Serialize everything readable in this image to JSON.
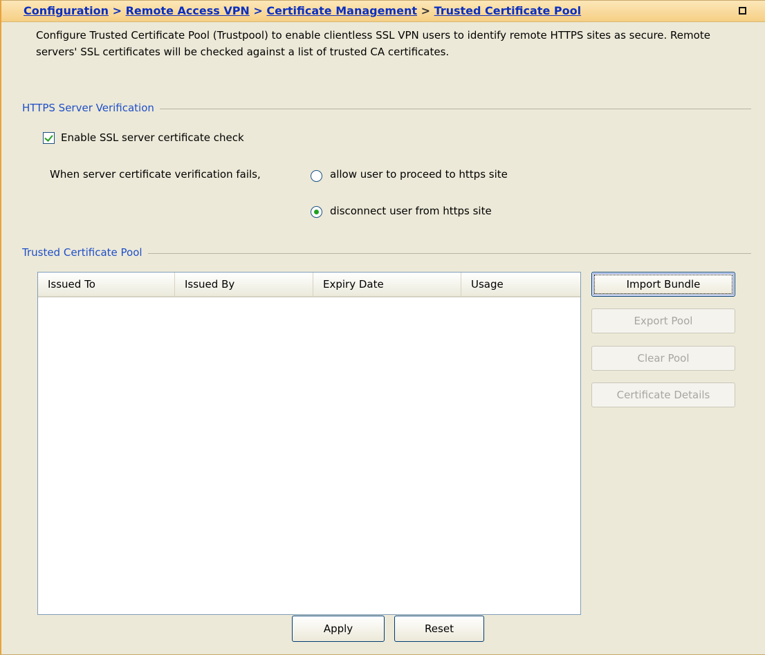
{
  "header": {
    "breadcrumb": [
      "Configuration",
      "Remote Access VPN",
      "Certificate Management",
      "Trusted Certificate Pool"
    ],
    "separator": ">"
  },
  "description": "Configure Trusted Certificate Pool (Trustpool) to enable clientless SSL VPN users to identify remote HTTPS sites as secure. Remote servers' SSL certificates will be checked against a list of trusted CA certificates.",
  "https_verification": {
    "title": "HTTPS Server Verification",
    "enable_check_label": "Enable SSL server certificate check",
    "enable_check_checked": true,
    "fail_prompt": "When server certificate verification fails,",
    "options": [
      {
        "label": "allow user to proceed to https site",
        "selected": false
      },
      {
        "label": "disconnect user from https site",
        "selected": true
      }
    ]
  },
  "trusted_pool": {
    "title": "Trusted Certificate Pool",
    "columns": [
      "Issued To",
      "Issued By",
      "Expiry Date",
      "Usage"
    ],
    "rows": [],
    "buttons": {
      "import_bundle": "Import Bundle",
      "export_pool": "Export Pool",
      "clear_pool": "Clear Pool",
      "certificate_details": "Certificate Details"
    }
  },
  "footer": {
    "apply": "Apply",
    "reset": "Reset"
  },
  "colors": {
    "header_bg": "#f6cf84",
    "link": "#0b2fc0",
    "group_title": "#1f4fc8",
    "panel_bg": "#ece9d8",
    "check_green": "#21a121"
  }
}
